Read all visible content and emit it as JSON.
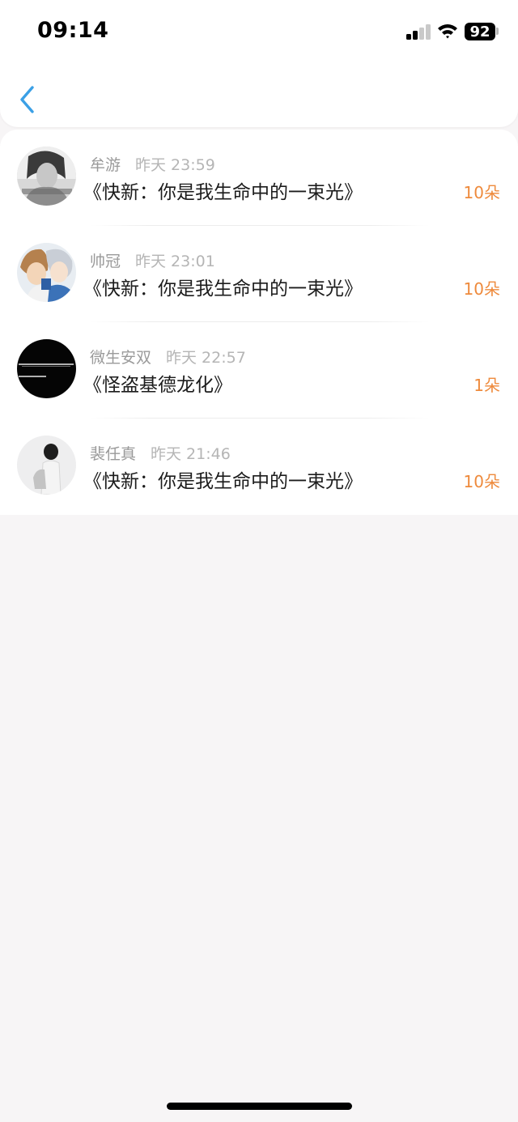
{
  "status_bar": {
    "time": "09:14",
    "battery": "92",
    "signal_bars_filled": 2,
    "signal_bars_total": 4
  },
  "nav": {
    "back_icon": "chevron-left-icon"
  },
  "colors": {
    "accent": "#3ba0e6",
    "amount": "#ee8a3c",
    "page_bg": "#f7f5f6"
  },
  "records": [
    {
      "user": "牟游",
      "time": "昨天 23:59",
      "book": "《快新：你是我生命中的一束光》",
      "amount": "10朵"
    },
    {
      "user": "帅冠",
      "time": "昨天 23:01",
      "book": "《快新：你是我生命中的一束光》",
      "amount": "10朵"
    },
    {
      "user": "微生安双",
      "time": "昨天 22:57",
      "book": "《怪盗基德龙化》",
      "amount": "1朵"
    },
    {
      "user": "裴任真",
      "time": "昨天 21:46",
      "book": "《快新：你是我生命中的一束光》",
      "amount": "10朵"
    }
  ]
}
